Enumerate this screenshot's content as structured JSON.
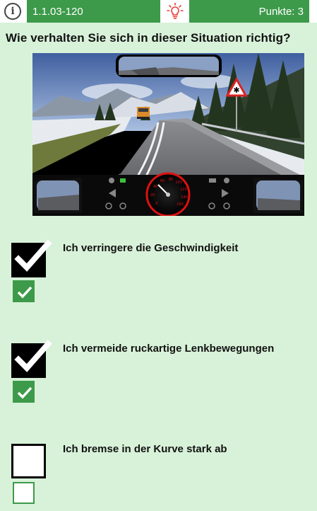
{
  "header": {
    "info_icon": "info-icon",
    "question_id": "1.1.03-120",
    "hint_icon": "lightbulb-icon",
    "score_text": "Punkte: 3"
  },
  "question": {
    "text": "Wie verhalten Sie sich in dieser Situation richtig?",
    "image_description_icon": "driving-scene-image"
  },
  "colors": {
    "accent": "#3d9a4a",
    "background": "#d8f2d9",
    "hint": "#e53935"
  },
  "answers": [
    {
      "text": "Ich verringere die Geschwindigkeit",
      "user_checked": true,
      "correct_checked": true
    },
    {
      "text": "Ich vermeide ruckartige Lenkbewegungen",
      "user_checked": true,
      "correct_checked": true
    },
    {
      "text": "Ich bremse in der Kurve stark ab",
      "user_checked": false,
      "correct_checked": false
    }
  ]
}
